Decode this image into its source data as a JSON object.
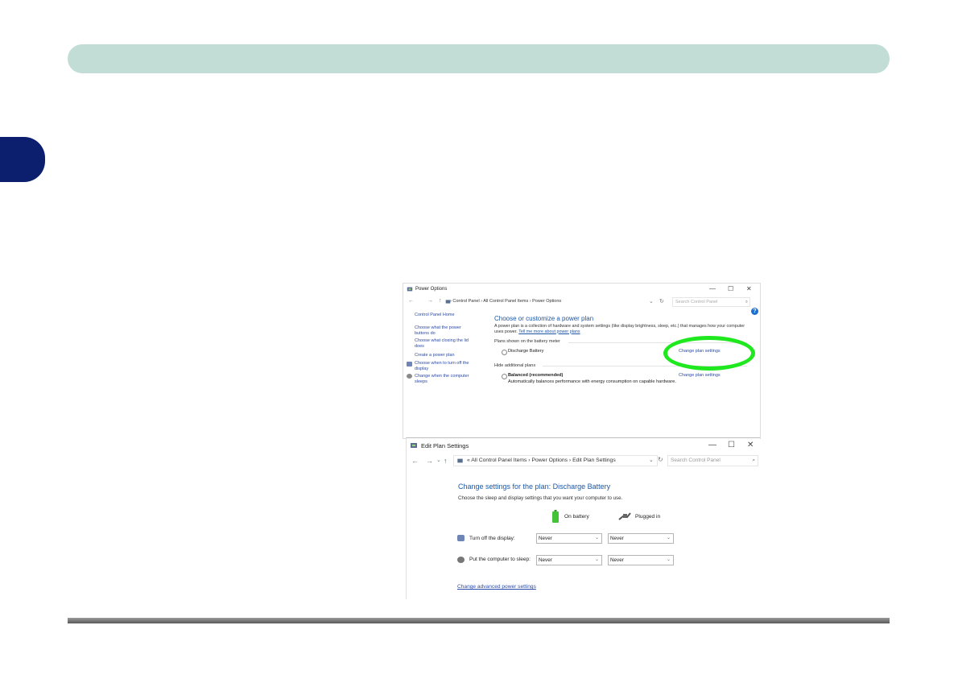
{
  "power_options": {
    "title": "Power Options",
    "controls": {
      "minimize": "—",
      "maximize": "☐",
      "close": "✕"
    },
    "nav": {
      "back": "←",
      "forward": "→",
      "up": "↑",
      "dropdown": "⌄",
      "refresh": "↻"
    },
    "breadcrumb": "›  Control Panel  ›  All Control Panel Items  ›  Power Options",
    "search_placeholder": "Search Control Panel",
    "search_icon": "⌕",
    "help": "?",
    "left_nav": [
      "Control Panel Home",
      "Choose what the power buttons do",
      "Choose what closing the lid does",
      "Create a power plan",
      "Choose when to turn off the display",
      "Change when the computer sleeps"
    ],
    "heading": "Choose or customize a power plan",
    "description": "A power plan is a collection of hardware and system settings (like display brightness, sleep, etc.) that manages how your computer uses power.",
    "description_link": "Tell me more about power plans",
    "section_battery_meter": "Plans shown on the battery meter",
    "plan1_name": "Discharge Battery",
    "plan1_link": "Change plan settings",
    "section_additional": "Hide additional plans",
    "plan2_name": "Balanced (recommended)",
    "plan2_link": "Change plan settings",
    "plan2_desc": "Automatically balances performance with energy consumption on capable hardware."
  },
  "edit_plan": {
    "title": "Edit Plan Settings",
    "controls": {
      "minimize": "—",
      "maximize": "☐",
      "close": "✕"
    },
    "nav": {
      "back": "←",
      "forward": "→",
      "recent": "⌄",
      "up": "↑",
      "dropdown": "⌄",
      "refresh": "↻"
    },
    "breadcrumb": "«  All Control Panel Items  ›  Power Options  ›  Edit Plan Settings",
    "search_placeholder": "Search Control Panel",
    "search_icon": "⌕",
    "heading": "Change settings for the plan: Discharge Battery",
    "subheading": "Choose the sleep and display settings that you want your computer to use.",
    "col_battery": "On battery",
    "col_plugged": "Plugged in",
    "row_display_label": "Turn off the display:",
    "row_sleep_label": "Put the computer to sleep:",
    "display_battery_value": "Never",
    "display_plugged_value": "Never",
    "sleep_battery_value": "Never",
    "sleep_plugged_value": "Never",
    "caret": "⌄",
    "advanced_link": "Change advanced power settings"
  },
  "colors": {
    "header_bar": "#c2dcd6",
    "side_tab": "#0b1f6e",
    "highlight_ellipse": "#1fe81f",
    "link": "#2a4aa8",
    "heading": "#1e57a6"
  }
}
